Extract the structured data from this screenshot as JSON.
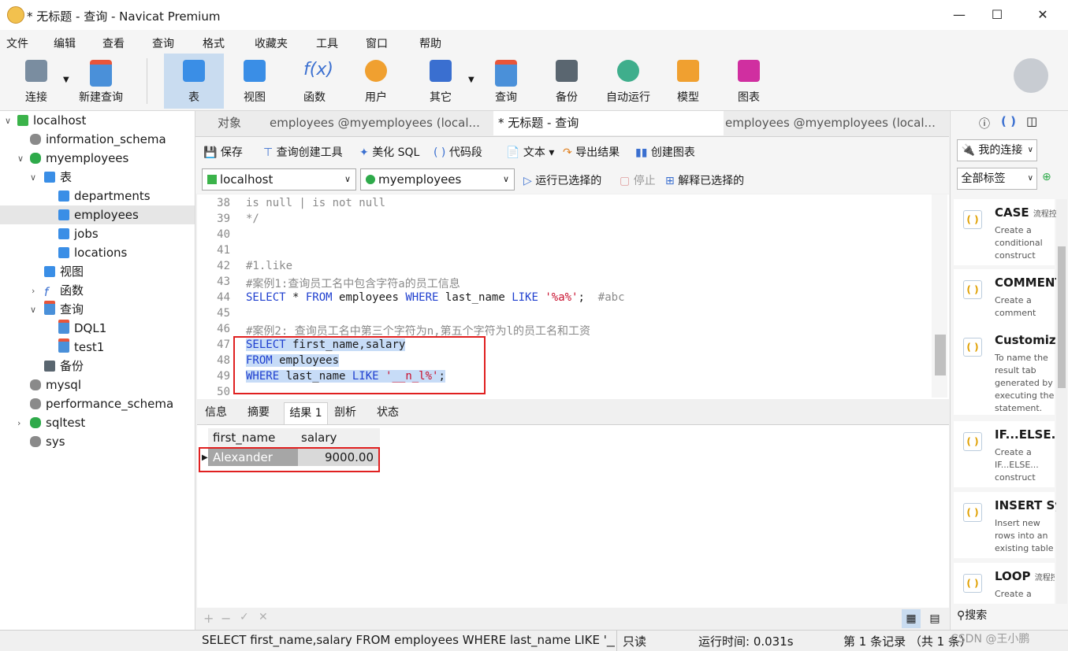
{
  "window": {
    "title": "* 无标题 - 查询 - Navicat Premium"
  },
  "menu": [
    "文件",
    "编辑",
    "查看",
    "查询",
    "格式",
    "收藏夹",
    "工具",
    "窗口",
    "帮助"
  ],
  "toolbar": [
    {
      "label": "连接",
      "icon": "connection-icon"
    },
    {
      "label": "新建查询",
      "icon": "new-query-icon"
    },
    {
      "label": "表",
      "icon": "table-icon"
    },
    {
      "label": "视图",
      "icon": "view-icon"
    },
    {
      "label": "函数",
      "icon": "function-icon"
    },
    {
      "label": "用户",
      "icon": "user-icon"
    },
    {
      "label": "其它",
      "icon": "other-icon"
    },
    {
      "label": "查询",
      "icon": "query-icon"
    },
    {
      "label": "备份",
      "icon": "backup-icon"
    },
    {
      "label": "自动运行",
      "icon": "automation-icon"
    },
    {
      "label": "模型",
      "icon": "model-icon"
    },
    {
      "label": "图表",
      "icon": "chart-icon"
    }
  ],
  "tree": [
    {
      "label": "localhost"
    },
    {
      "label": "information_schema"
    },
    {
      "label": "myemployees"
    },
    {
      "label": "表"
    },
    {
      "label": "departments"
    },
    {
      "label": "employees"
    },
    {
      "label": "jobs"
    },
    {
      "label": "locations"
    },
    {
      "label": "视图"
    },
    {
      "label": "函数"
    },
    {
      "label": "查询"
    },
    {
      "label": "DQL1"
    },
    {
      "label": "test1"
    },
    {
      "label": "备份"
    },
    {
      "label": "mysql"
    },
    {
      "label": "performance_schema"
    },
    {
      "label": "sqltest"
    },
    {
      "label": "sys"
    }
  ],
  "tabs": [
    "对象",
    "employees @myemployees (local...",
    "* 无标题 - 查询",
    "employees @myemployees (local..."
  ],
  "editor_tools": [
    "保存",
    "查询创建工具",
    "美化 SQL",
    "代码段",
    "文本",
    "导出结果",
    "创建图表"
  ],
  "connection": {
    "server": "localhost",
    "database": "myemployees",
    "run": "运行已选择的",
    "stop": "停止",
    "explain": "解释已选择的"
  },
  "editor": {
    "lines": [
      {
        "n": "38",
        "t": "is null | is not null"
      },
      {
        "n": "39",
        "t": "*/"
      },
      {
        "n": "40",
        "t": ""
      },
      {
        "n": "41",
        "t": ""
      },
      {
        "n": "42",
        "t": "#1.like"
      },
      {
        "n": "43",
        "t": "#案例1:查询员工名中包含字符a的员工信息"
      },
      {
        "n": "44",
        "t": "SELECT * FROM employees WHERE last_name LIKE '%a%';  #abc"
      },
      {
        "n": "45",
        "t": ""
      },
      {
        "n": "46",
        "t": "#案例2: 查询员工名中第三个字符为n,第五个字符为l的员工名和工资"
      },
      {
        "n": "47",
        "t": "SELECT first_name,salary"
      },
      {
        "n": "48",
        "t": "FROM employees"
      },
      {
        "n": "49",
        "t": "WHERE last_name LIKE '__n_l%';"
      },
      {
        "n": "50",
        "t": ""
      }
    ]
  },
  "result_tabs": [
    "信息",
    "摘要",
    "结果 1",
    "剖析",
    "状态"
  ],
  "grid": {
    "columns": [
      "first_name",
      "salary"
    ],
    "rows": [
      [
        "Alexander",
        "9000.00"
      ]
    ]
  },
  "status": {
    "sql": "SELECT first_name,salary  FROM employees  WHERE last_name LIKE '__n_l",
    "mode": "只读",
    "time": "运行时间: 0.031s",
    "record": "第 1 条记录 （共 1 条）",
    "watermark": "CSDN @王小鹏"
  },
  "rpanel": {
    "conn_dropdown": "我的连接",
    "tag_dropdown": "全部标签",
    "search": "搜索",
    "snippets": [
      {
        "title": "CASE",
        "tag": "流程控",
        "desc": "Create a conditional construct"
      },
      {
        "title": "COMMENT",
        "tag": "",
        "desc": "Create a comment"
      },
      {
        "title": "Customize",
        "tag": "",
        "desc": "To name the result tab generated by executing the statement."
      },
      {
        "title": "IF...ELSE...",
        "tag": "",
        "desc": "Create a IF...ELSE... construct"
      },
      {
        "title": "INSERT Sy",
        "tag": "",
        "desc": "Insert new rows into an existing table"
      },
      {
        "title": "LOOP",
        "tag": "流程控",
        "desc": "Create a"
      }
    ]
  }
}
